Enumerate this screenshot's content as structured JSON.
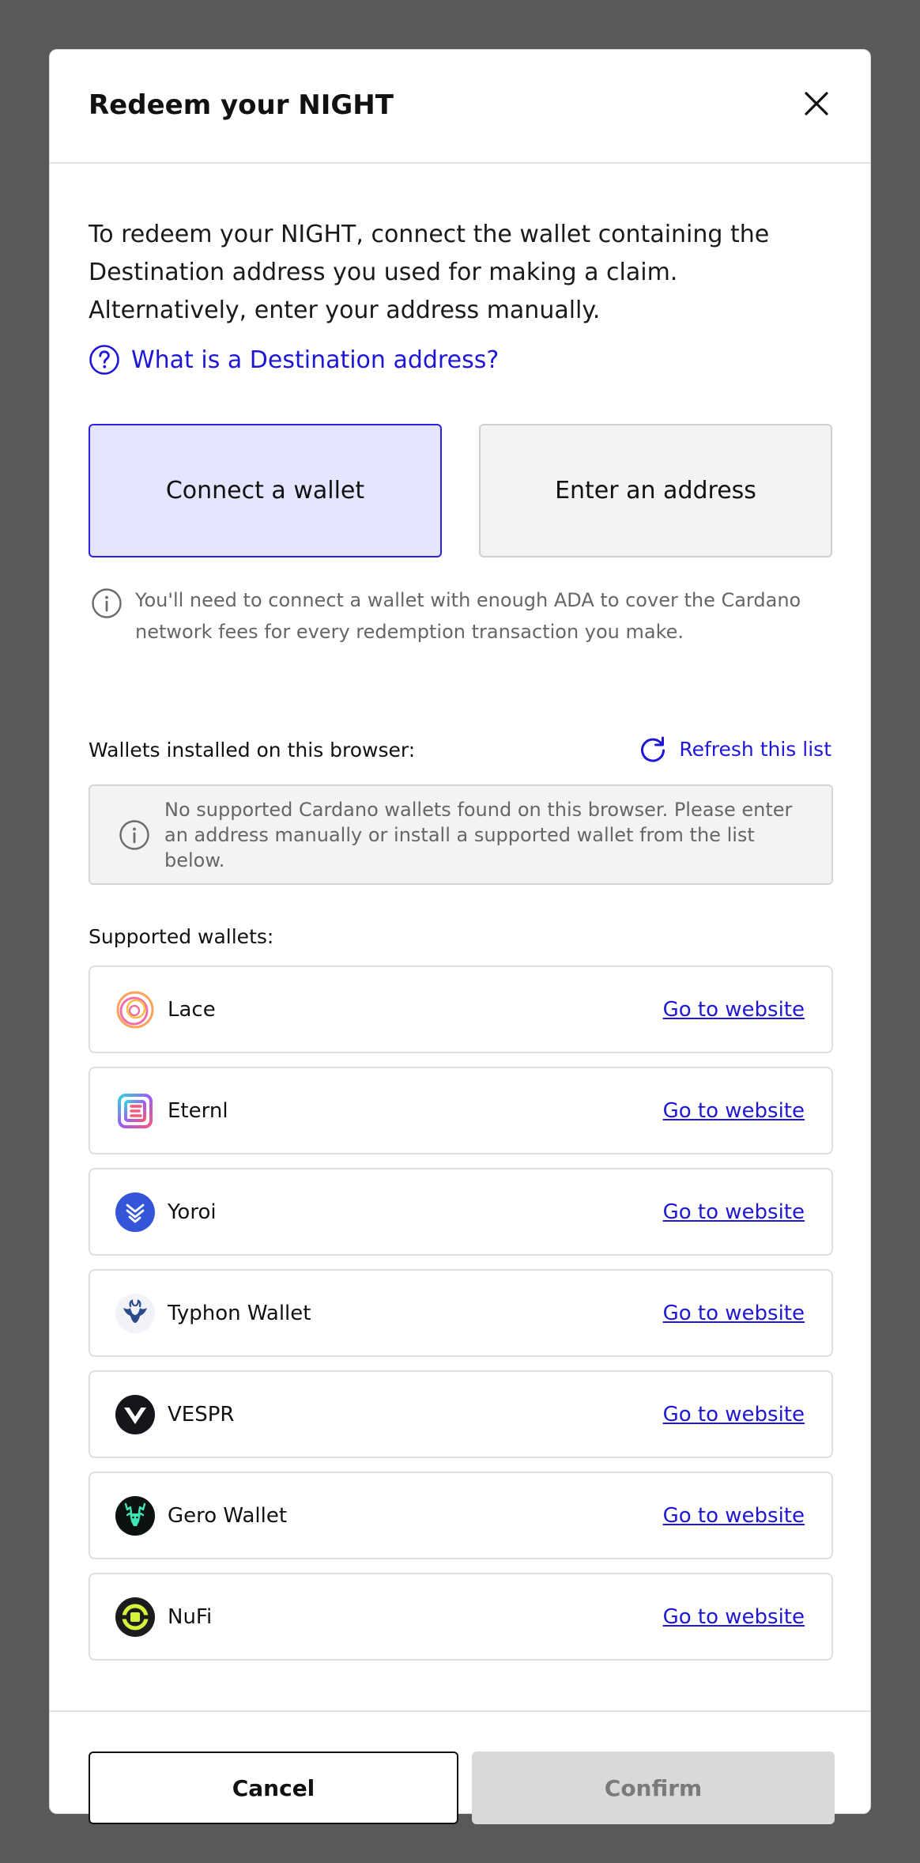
{
  "modal": {
    "title": "Redeem your NIGHT",
    "intro": "To redeem your NIGHT, connect the wallet containing the Destination address you used for making a claim. Alternatively, enter your address manually.",
    "help_link": "What is a Destination address?"
  },
  "tabs": {
    "connect_wallet": "Connect a wallet",
    "enter_address": "Enter an address",
    "selected": "connect_wallet"
  },
  "fee_note": "You'll need to connect a wallet with enough ADA to cover the Cardano network fees for every redemption transaction you make.",
  "installed": {
    "label": "Wallets installed on this browser:",
    "refresh_label": "Refresh this list",
    "empty_message": "No supported Cardano wallets found on this browser. Please enter an address manually or install a supported wallet from the list below."
  },
  "supported": {
    "label": "Supported wallets:",
    "link_label": "Go to website",
    "wallets": [
      {
        "name": "Lace",
        "icon": "lace-logo-icon"
      },
      {
        "name": "Eternl",
        "icon": "eternl-logo-icon"
      },
      {
        "name": "Yoroi",
        "icon": "yoroi-logo-icon"
      },
      {
        "name": "Typhon Wallet",
        "icon": "typhon-logo-icon"
      },
      {
        "name": "VESPR",
        "icon": "vespr-logo-icon"
      },
      {
        "name": "Gero Wallet",
        "icon": "gero-logo-icon"
      },
      {
        "name": "NuFi",
        "icon": "nufi-logo-icon"
      }
    ]
  },
  "footer": {
    "cancel_label": "Cancel",
    "confirm_label": "Confirm",
    "confirm_disabled": true
  },
  "colors": {
    "accent": "#1f17d6",
    "selected_tab_bg": "#e5e5ff",
    "backdrop": "#595959",
    "disabled_button": "#d9d9d9"
  }
}
